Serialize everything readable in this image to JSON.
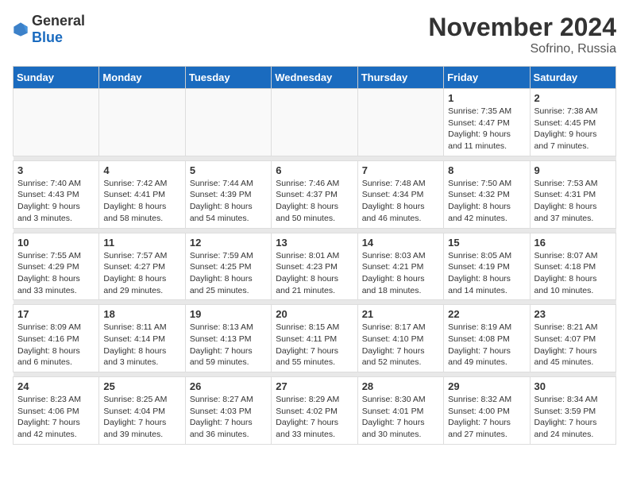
{
  "logo": {
    "text_general": "General",
    "text_blue": "Blue"
  },
  "title": "November 2024",
  "location": "Sofrino, Russia",
  "days_of_week": [
    "Sunday",
    "Monday",
    "Tuesday",
    "Wednesday",
    "Thursday",
    "Friday",
    "Saturday"
  ],
  "weeks": [
    [
      {
        "day": "",
        "info": ""
      },
      {
        "day": "",
        "info": ""
      },
      {
        "day": "",
        "info": ""
      },
      {
        "day": "",
        "info": ""
      },
      {
        "day": "",
        "info": ""
      },
      {
        "day": "1",
        "info": "Sunrise: 7:35 AM\nSunset: 4:47 PM\nDaylight: 9 hours\nand 11 minutes."
      },
      {
        "day": "2",
        "info": "Sunrise: 7:38 AM\nSunset: 4:45 PM\nDaylight: 9 hours\nand 7 minutes."
      }
    ],
    [
      {
        "day": "3",
        "info": "Sunrise: 7:40 AM\nSunset: 4:43 PM\nDaylight: 9 hours\nand 3 minutes."
      },
      {
        "day": "4",
        "info": "Sunrise: 7:42 AM\nSunset: 4:41 PM\nDaylight: 8 hours\nand 58 minutes."
      },
      {
        "day": "5",
        "info": "Sunrise: 7:44 AM\nSunset: 4:39 PM\nDaylight: 8 hours\nand 54 minutes."
      },
      {
        "day": "6",
        "info": "Sunrise: 7:46 AM\nSunset: 4:37 PM\nDaylight: 8 hours\nand 50 minutes."
      },
      {
        "day": "7",
        "info": "Sunrise: 7:48 AM\nSunset: 4:34 PM\nDaylight: 8 hours\nand 46 minutes."
      },
      {
        "day": "8",
        "info": "Sunrise: 7:50 AM\nSunset: 4:32 PM\nDaylight: 8 hours\nand 42 minutes."
      },
      {
        "day": "9",
        "info": "Sunrise: 7:53 AM\nSunset: 4:31 PM\nDaylight: 8 hours\nand 37 minutes."
      }
    ],
    [
      {
        "day": "10",
        "info": "Sunrise: 7:55 AM\nSunset: 4:29 PM\nDaylight: 8 hours\nand 33 minutes."
      },
      {
        "day": "11",
        "info": "Sunrise: 7:57 AM\nSunset: 4:27 PM\nDaylight: 8 hours\nand 29 minutes."
      },
      {
        "day": "12",
        "info": "Sunrise: 7:59 AM\nSunset: 4:25 PM\nDaylight: 8 hours\nand 25 minutes."
      },
      {
        "day": "13",
        "info": "Sunrise: 8:01 AM\nSunset: 4:23 PM\nDaylight: 8 hours\nand 21 minutes."
      },
      {
        "day": "14",
        "info": "Sunrise: 8:03 AM\nSunset: 4:21 PM\nDaylight: 8 hours\nand 18 minutes."
      },
      {
        "day": "15",
        "info": "Sunrise: 8:05 AM\nSunset: 4:19 PM\nDaylight: 8 hours\nand 14 minutes."
      },
      {
        "day": "16",
        "info": "Sunrise: 8:07 AM\nSunset: 4:18 PM\nDaylight: 8 hours\nand 10 minutes."
      }
    ],
    [
      {
        "day": "17",
        "info": "Sunrise: 8:09 AM\nSunset: 4:16 PM\nDaylight: 8 hours\nand 6 minutes."
      },
      {
        "day": "18",
        "info": "Sunrise: 8:11 AM\nSunset: 4:14 PM\nDaylight: 8 hours\nand 3 minutes."
      },
      {
        "day": "19",
        "info": "Sunrise: 8:13 AM\nSunset: 4:13 PM\nDaylight: 7 hours\nand 59 minutes."
      },
      {
        "day": "20",
        "info": "Sunrise: 8:15 AM\nSunset: 4:11 PM\nDaylight: 7 hours\nand 55 minutes."
      },
      {
        "day": "21",
        "info": "Sunrise: 8:17 AM\nSunset: 4:10 PM\nDaylight: 7 hours\nand 52 minutes."
      },
      {
        "day": "22",
        "info": "Sunrise: 8:19 AM\nSunset: 4:08 PM\nDaylight: 7 hours\nand 49 minutes."
      },
      {
        "day": "23",
        "info": "Sunrise: 8:21 AM\nSunset: 4:07 PM\nDaylight: 7 hours\nand 45 minutes."
      }
    ],
    [
      {
        "day": "24",
        "info": "Sunrise: 8:23 AM\nSunset: 4:06 PM\nDaylight: 7 hours\nand 42 minutes."
      },
      {
        "day": "25",
        "info": "Sunrise: 8:25 AM\nSunset: 4:04 PM\nDaylight: 7 hours\nand 39 minutes."
      },
      {
        "day": "26",
        "info": "Sunrise: 8:27 AM\nSunset: 4:03 PM\nDaylight: 7 hours\nand 36 minutes."
      },
      {
        "day": "27",
        "info": "Sunrise: 8:29 AM\nSunset: 4:02 PM\nDaylight: 7 hours\nand 33 minutes."
      },
      {
        "day": "28",
        "info": "Sunrise: 8:30 AM\nSunset: 4:01 PM\nDaylight: 7 hours\nand 30 minutes."
      },
      {
        "day": "29",
        "info": "Sunrise: 8:32 AM\nSunset: 4:00 PM\nDaylight: 7 hours\nand 27 minutes."
      },
      {
        "day": "30",
        "info": "Sunrise: 8:34 AM\nSunset: 3:59 PM\nDaylight: 7 hours\nand 24 minutes."
      }
    ]
  ]
}
